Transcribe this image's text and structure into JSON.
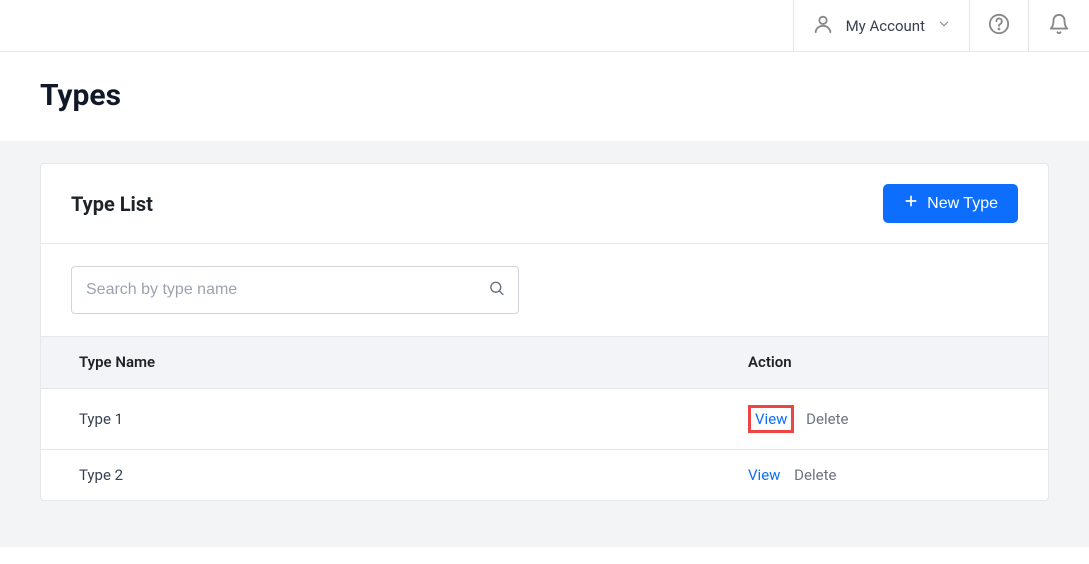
{
  "header": {
    "account_label": "My Account"
  },
  "page": {
    "title": "Types"
  },
  "card": {
    "title": "Type List",
    "new_button": "New Type",
    "search_placeholder": "Search by type name"
  },
  "table": {
    "columns": {
      "name": "Type Name",
      "action": "Action"
    },
    "rows": [
      {
        "name": "Type 1",
        "view": "View",
        "delete": "Delete",
        "highlighted": true
      },
      {
        "name": "Type 2",
        "view": "View",
        "delete": "Delete",
        "highlighted": false
      }
    ]
  }
}
